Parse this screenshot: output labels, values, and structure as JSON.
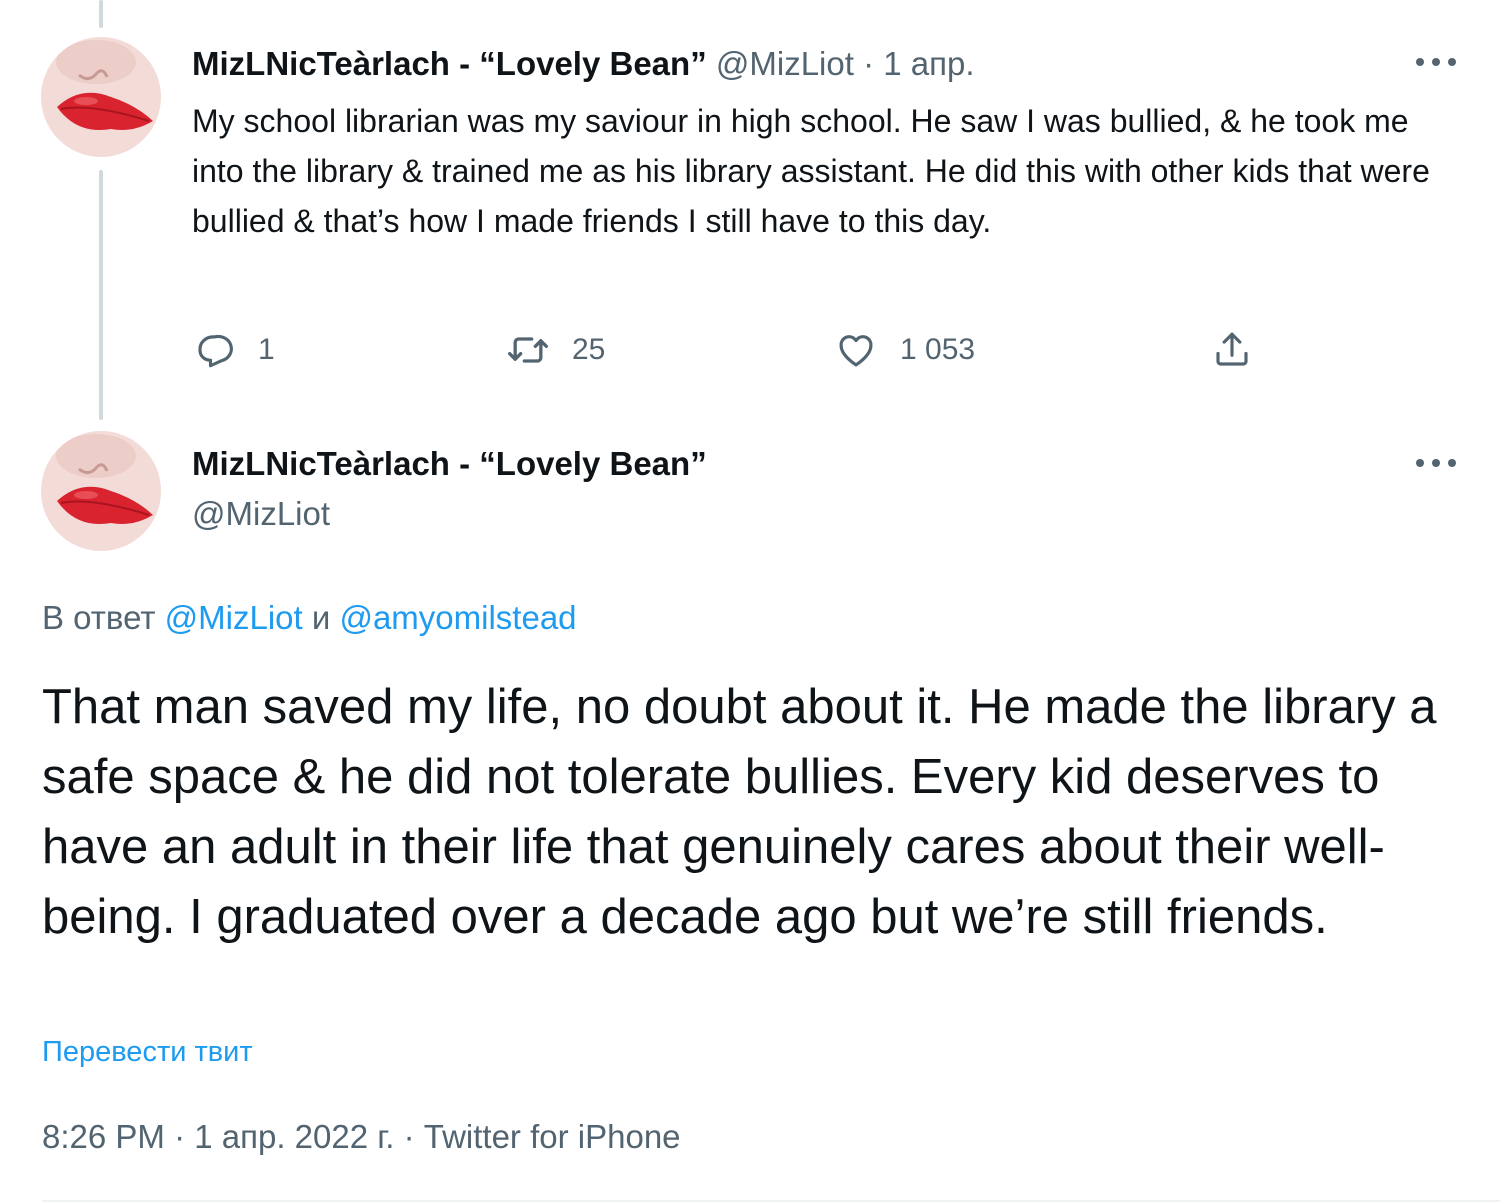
{
  "tweet1": {
    "display_name": "MizLNicTeàrlach - “Lovely Bean”",
    "handle": "@MizLiot",
    "separator": "·",
    "date": "1 апр.",
    "text": "My school librarian was my saviour in high school. He saw I was bullied, & he took me into the library & trained me as his library assistant. He did this with other kids that were bullied & that’s how I made friends I still have to this day.",
    "actions": {
      "reply_icon": "reply-icon",
      "reply_count": "1",
      "retweet_icon": "retweet-icon",
      "retweet_count": "25",
      "like_icon": "heart-icon",
      "like_count": "1 053",
      "share_icon": "share-icon"
    }
  },
  "tweet2": {
    "display_name": "MizLNicTeàrlach - “Lovely Bean”",
    "handle": "@MizLiot",
    "reply_prefix": "В ответ",
    "reply_user1": "@MizLiot",
    "reply_conj": "и",
    "reply_user2": "@amyomilstead",
    "text": "That man saved my life, no doubt about it. He made the library a safe space & he did not tolerate bullies. Every kid deserves to have an adult in their life that genuinely cares about their well-being. I graduated over a decade ago but we’re still friends.",
    "translate_label": "Перевести твит",
    "timestamp": "8:26 PM · 1 апр. 2022 г. · Twitter for iPhone"
  },
  "colors": {
    "text": "#0f1419",
    "secondary": "#536471",
    "accent": "#1d9bf0",
    "thread_line": "#cfd9de",
    "lips": "#d9232f"
  }
}
